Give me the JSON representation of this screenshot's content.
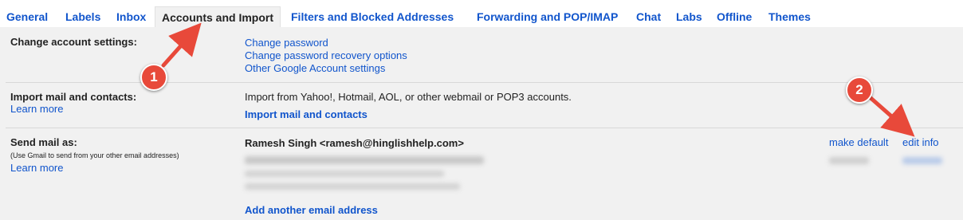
{
  "tabs": [
    {
      "label": "General"
    },
    {
      "label": "Labels"
    },
    {
      "label": "Inbox"
    },
    {
      "label": "Accounts and Import",
      "active": true
    },
    {
      "label": "Filters and Blocked Addresses"
    },
    {
      "label": "Forwarding and POP/IMAP"
    },
    {
      "label": "Chat"
    },
    {
      "label": "Labs"
    },
    {
      "label": "Offline"
    },
    {
      "label": "Themes"
    }
  ],
  "change_account": {
    "title": "Change account settings:",
    "links": [
      "Change password",
      "Change password recovery options",
      "Other Google Account settings"
    ]
  },
  "import_mail": {
    "title": "Import mail and contacts:",
    "learn_more": "Learn more",
    "description": "Import from Yahoo!, Hotmail, AOL, or other webmail or POP3 accounts.",
    "action": "Import mail and contacts"
  },
  "send_mail_as": {
    "title": "Send mail as:",
    "note": "(Use Gmail to send from your other email addresses)",
    "learn_more": "Learn more",
    "identity": "Ramesh Singh <ramesh@hinglishhelp.com>",
    "make_default": "make default",
    "edit_info": "edit info",
    "add_address": "Add another email address"
  },
  "annotations": {
    "callout_1": "1",
    "callout_2": "2",
    "color": "#e8493a"
  }
}
